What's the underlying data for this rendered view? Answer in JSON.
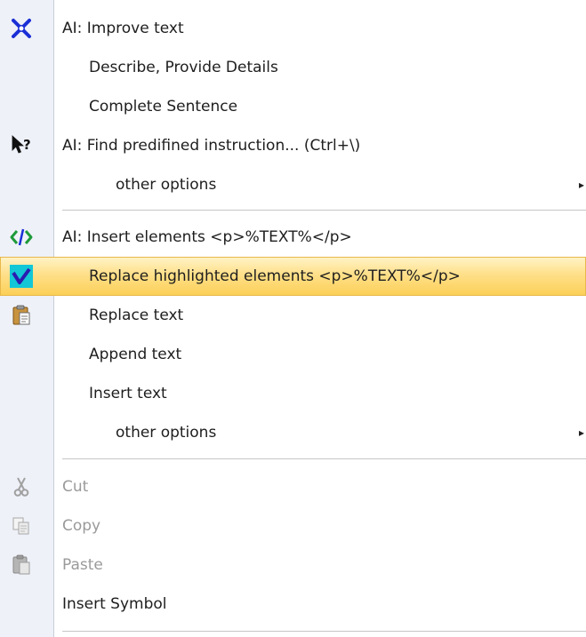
{
  "menu": {
    "items": [
      {
        "label": "AI: Improve text",
        "icon": "blue-x-icon"
      },
      {
        "label": "Describe, Provide Details"
      },
      {
        "label": "Complete Sentence"
      },
      {
        "label": "AI:  Find predifined instruction... (Ctrl+\\)",
        "icon": "pointer-help-icon"
      },
      {
        "label": "other options",
        "submenu_arrow": "▸"
      },
      {
        "label": "AI: Insert elements <p>%TEXT%</p>",
        "icon": "code-tag-icon"
      },
      {
        "label": "Replace highlighted elements <p>%TEXT%</p>",
        "icon": "checkmark-icon",
        "highlighted": true
      },
      {
        "label": "Replace text",
        "icon": "clipboard-icon"
      },
      {
        "label": "Append text"
      },
      {
        "label": "Insert text"
      },
      {
        "label": "other options",
        "submenu_arrow": "▸"
      },
      {
        "label": "Cut",
        "icon": "scissors-icon",
        "disabled": true
      },
      {
        "label": "Copy",
        "icon": "copy-icon",
        "disabled": true
      },
      {
        "label": "Paste",
        "icon": "paste-icon",
        "disabled": true
      },
      {
        "label": "Insert Symbol"
      }
    ]
  },
  "colors": {
    "highlight": "#fbcf55",
    "gutter": "#eef1f8",
    "disabled_text": "#9a9a9a",
    "accent_blue": "#1a2fd6",
    "accent_green": "#1e9a3a",
    "accent_cyan": "#13c7d6"
  }
}
